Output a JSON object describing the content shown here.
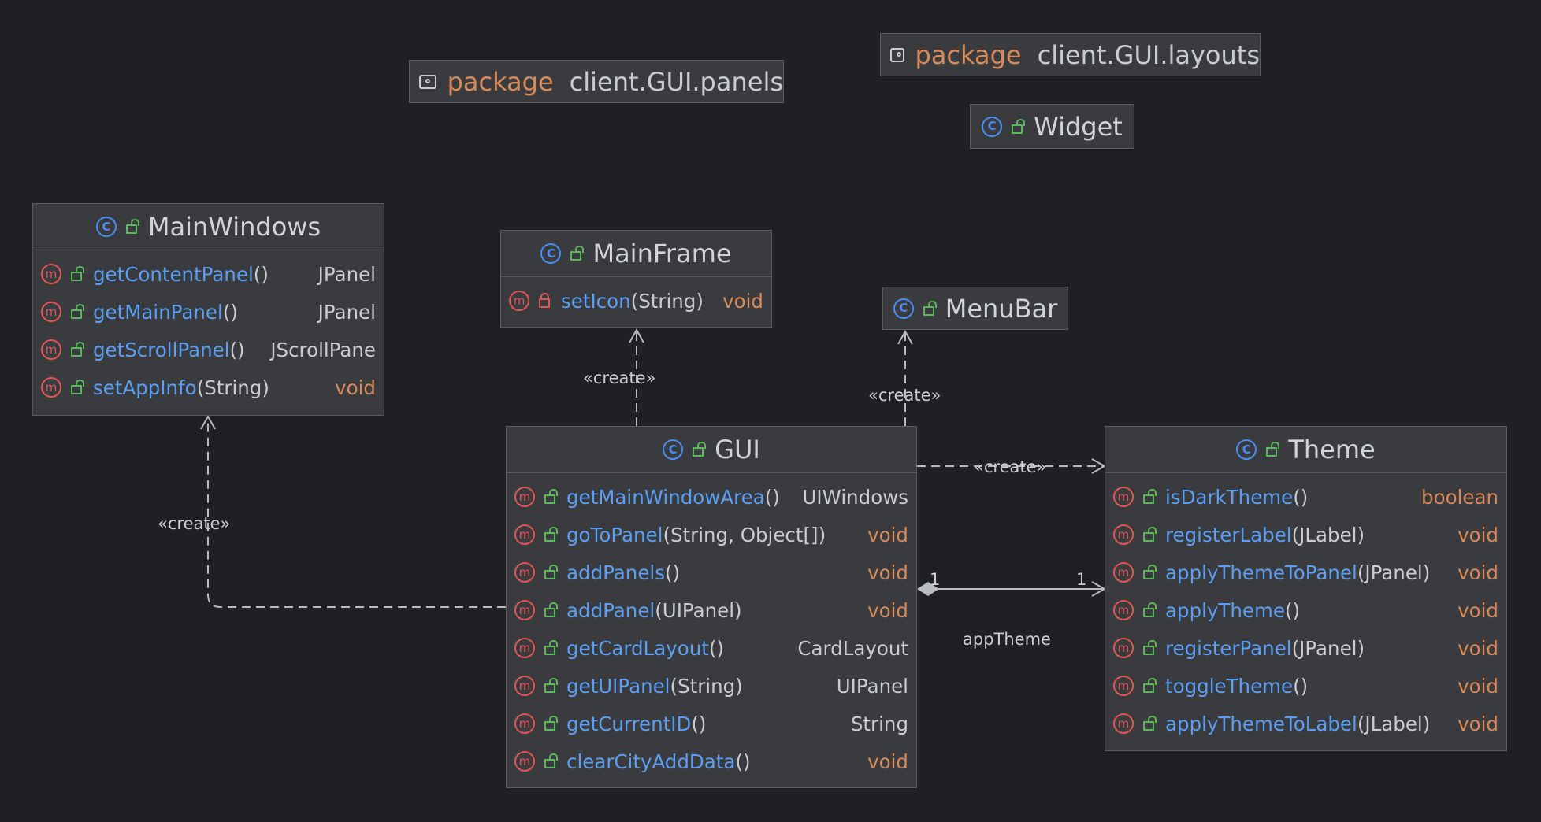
{
  "packages": [
    {
      "keyword": "package",
      "name": "client.GUI.panels"
    },
    {
      "keyword": "package",
      "name": "client.GUI.layouts"
    }
  ],
  "classes": {
    "widget": {
      "name": "Widget"
    },
    "menubar": {
      "name": "MenuBar"
    },
    "mainwindows": {
      "name": "MainWindows",
      "methods": [
        {
          "name": "getContentPanel",
          "args": "()",
          "ret": "JPanel"
        },
        {
          "name": "getMainPanel",
          "args": "()",
          "ret": "JPanel"
        },
        {
          "name": "getScrollPanel",
          "args": "()",
          "ret": "JScrollPane"
        },
        {
          "name": "setAppInfo",
          "args": "(String)",
          "ret": "void"
        }
      ]
    },
    "mainframe": {
      "name": "MainFrame",
      "methods": [
        {
          "name": "setIcon",
          "args": "(String)",
          "ret": "void"
        }
      ]
    },
    "gui": {
      "name": "GUI",
      "methods": [
        {
          "name": "getMainWindowArea",
          "args": "()",
          "ret": "UIWindows"
        },
        {
          "name": "goToPanel",
          "args": "(String, Object[])",
          "ret": "void"
        },
        {
          "name": "addPanels",
          "args": "()",
          "ret": "void"
        },
        {
          "name": "addPanel",
          "args": "(UIPanel)",
          "ret": "void"
        },
        {
          "name": "getCardLayout",
          "args": "()",
          "ret": "CardLayout"
        },
        {
          "name": "getUIPanel",
          "args": "(String)",
          "ret": "UIPanel"
        },
        {
          "name": "getCurrentID",
          "args": "()",
          "ret": "String"
        },
        {
          "name": "clearCityAddData",
          "args": "()",
          "ret": "void"
        }
      ]
    },
    "theme": {
      "name": "Theme",
      "methods": [
        {
          "name": "isDarkTheme",
          "args": "()",
          "ret": "boolean"
        },
        {
          "name": "registerLabel",
          "args": "(JLabel)",
          "ret": "void"
        },
        {
          "name": "applyThemeToPanel",
          "args": "(JPanel)",
          "ret": "void"
        },
        {
          "name": "applyTheme",
          "args": "()",
          "ret": "void"
        },
        {
          "name": "registerPanel",
          "args": "(JPanel)",
          "ret": "void"
        },
        {
          "name": "toggleTheme",
          "args": "()",
          "ret": "void"
        },
        {
          "name": "applyThemeToLabel",
          "args": "(JLabel)",
          "ret": "void"
        }
      ]
    }
  },
  "edges": {
    "create_label": "«create»",
    "association_label": "appTheme",
    "mult_left": "1",
    "mult_right": "1"
  },
  "icons": {
    "class_icon": "C",
    "method_icon": "m"
  },
  "colors": {
    "background": "#1f2024",
    "box_fill": "#3a3b3e",
    "method_name": "#5c9ff2",
    "keyword": "#d88a5a",
    "class_icon": "#4a8df0",
    "method_icon": "#e05555",
    "public_lock": "#5bb85b"
  }
}
